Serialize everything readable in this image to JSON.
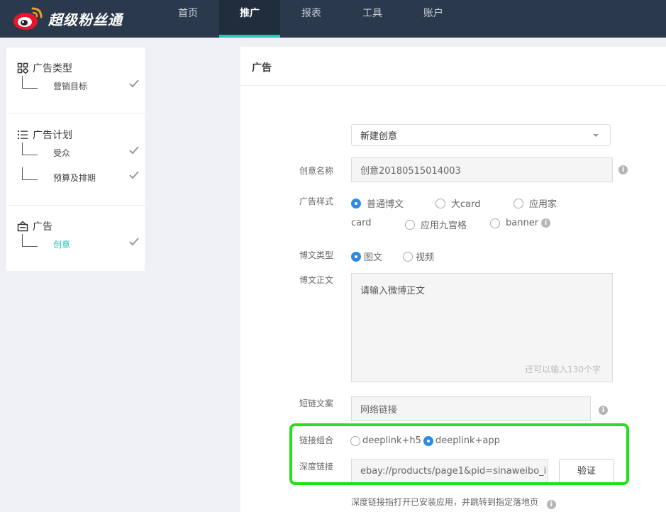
{
  "app": {
    "title": "超级粉丝通",
    "colors": {
      "nav_bg": "#2a3a4c",
      "accent": "#2bc5b4",
      "radio_on": "#2f8ae6",
      "highlight": "#22e01e"
    }
  },
  "nav": {
    "items": [
      {
        "label": "首页"
      },
      {
        "label": "推广"
      },
      {
        "label": "报表"
      },
      {
        "label": "工具"
      },
      {
        "label": "账户"
      }
    ],
    "active": "推广"
  },
  "sidebar": {
    "groups": [
      {
        "title": "广告类型",
        "icon": "grid-icon",
        "items": [
          {
            "label": "营销目标",
            "checked": true
          }
        ]
      },
      {
        "title": "广告计划",
        "icon": "list-icon",
        "items": [
          {
            "label": "受众",
            "checked": true
          },
          {
            "label": "预算及排期",
            "checked": true
          }
        ]
      },
      {
        "title": "广告",
        "icon": "ad-box-icon",
        "items": [
          {
            "label": "创意",
            "checked": true,
            "active": true
          }
        ]
      }
    ]
  },
  "main": {
    "title": "广告",
    "creative_select": {
      "value": "新建创意"
    },
    "creative_name": {
      "label": "创意名称",
      "value": "创意20180515014003"
    },
    "ad_style": {
      "label": "广告样式",
      "options": [
        {
          "label": "普通博文",
          "selected": true
        },
        {
          "label": "大card",
          "selected": false
        },
        {
          "label": "应用家",
          "selected": false
        },
        {
          "label": "应用九宫格",
          "selected": false
        },
        {
          "label": "banner",
          "selected": false
        }
      ],
      "wrap_text": "card"
    },
    "post_type": {
      "label": "博文类型",
      "options": [
        {
          "label": "图文",
          "selected": true
        },
        {
          "label": "视频",
          "selected": false
        }
      ]
    },
    "post_body": {
      "label": "博文正文",
      "placeholder": "请输入微博正文",
      "counter": "还可以输入130个字"
    },
    "short_link": {
      "label": "短链文案",
      "value": "网络链接"
    },
    "link_combo": {
      "label": "链接组合",
      "options": [
        {
          "label": "deeplink+h5",
          "selected": false
        },
        {
          "label": "deeplink+app",
          "selected": true
        }
      ]
    },
    "deep_link": {
      "label": "深度链接",
      "value": "ebay://products/page1&pid=sinaweibo_i",
      "verify_label": "验证"
    },
    "hint": "深度链接指打开已安装应用，并跳转到指定落地页"
  }
}
